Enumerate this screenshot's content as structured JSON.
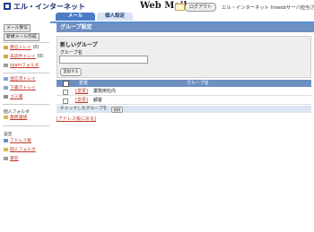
{
  "header": {
    "brand": "エル・インターネット",
    "app_title": "Web Mail",
    "logout_label": "ログアウト",
    "user_label": "エル・インターネット linwebサーバ担当さん"
  },
  "tabs": [
    {
      "label": "メール",
      "active": true
    },
    {
      "label": "個人設定",
      "active": false
    }
  ],
  "sidebar": {
    "check_mail_label": "メール受信",
    "compose_label": "新規メール作成",
    "folders": [
      {
        "label": "受信トレイ",
        "count": "(0)",
        "icon": "inbox-icon"
      },
      {
        "label": "未読件トレイ",
        "count": "(0)",
        "icon": "unread-icon"
      },
      {
        "label": "spamフォルダ",
        "count": "",
        "icon": "spam-icon"
      }
    ],
    "folders2": [
      {
        "label": "送信済トレイ",
        "count": "",
        "icon": "sent-icon"
      },
      {
        "label": "下書きトレイ",
        "count": "",
        "icon": "draft-icon"
      },
      {
        "label": "ゴミ箱",
        "count": "",
        "icon": "trash-icon"
      }
    ],
    "personal_folder_heading": "個人フォルダ",
    "personal_folders": [
      {
        "label": "業務連絡",
        "icon": "folder-icon"
      }
    ],
    "settings_heading": "設定",
    "settings_items": [
      {
        "label": "アドレス帳",
        "icon": "address-book-icon"
      },
      {
        "label": "個人フォルダ",
        "icon": "folder-icon"
      },
      {
        "label": "署名",
        "icon": "signature-icon"
      }
    ]
  },
  "main": {
    "title": "グループ設定",
    "new_group_heading": "新しいグループ",
    "group_name_label": "グループ名",
    "group_name_value": "",
    "add_button_label": "追加する",
    "table": {
      "col_edit": "変更",
      "col_name": "グループ名",
      "rows": [
        {
          "edit": "[変更]",
          "name": "業務用社内"
        },
        {
          "edit": "[変更]",
          "name": "顧客"
        }
      ]
    },
    "footer_text": "チェックしたグループを",
    "delete_button_label": "削除",
    "back_link": "[アドレス帳に戻る]"
  },
  "colors": {
    "accent": "#4a7cc6",
    "title_bar": "#6d8fc1",
    "link": "#c0392b"
  }
}
